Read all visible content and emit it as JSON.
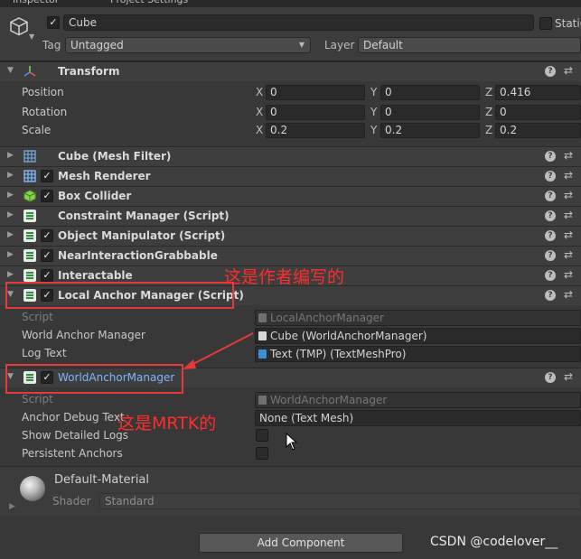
{
  "tabs": [
    "Inspector",
    "Project Settings"
  ],
  "object": {
    "name": "Cube",
    "static_label": "Static",
    "tag_label": "Tag",
    "tag_value": "Untagged",
    "layer_label": "Layer",
    "layer_value": "Default"
  },
  "transform": {
    "title": "Transform",
    "rows": [
      {
        "label": "Position",
        "x": "0",
        "y": "0",
        "z": "0.416"
      },
      {
        "label": "Rotation",
        "x": "0",
        "y": "0",
        "z": "0"
      },
      {
        "label": "Scale",
        "x": "0.2",
        "y": "0.2",
        "z": "0.2"
      }
    ],
    "axes": {
      "x": "X",
      "y": "Y",
      "z": "Z"
    }
  },
  "components": [
    {
      "name": "Cube (Mesh Filter)",
      "icon": "mesh-filter-icon",
      "checkbox": false
    },
    {
      "name": "Mesh Renderer",
      "icon": "mesh-renderer-icon",
      "checkbox": true
    },
    {
      "name": "Box Collider",
      "icon": "box-collider-icon",
      "checkbox": true
    },
    {
      "name": "Constraint Manager (Script)",
      "icon": "script-icon",
      "checkbox": false
    },
    {
      "name": "Object Manipulator (Script)",
      "icon": "script-icon",
      "checkbox": true
    },
    {
      "name": "NearInteractionGrabbable",
      "icon": "script-icon",
      "checkbox": true
    },
    {
      "name": "Interactable",
      "icon": "script-icon",
      "checkbox": true
    }
  ],
  "local_anchor": {
    "title": "Local Anchor Manager (Script)",
    "script_label": "Script",
    "script_value": "LocalAnchorManager",
    "wam_label": "World Anchor Manager",
    "wam_value": "Cube (WorldAnchorManager)",
    "log_label": "Log Text",
    "log_value": "Text (TMP) (TextMeshPro)"
  },
  "world_anchor": {
    "title": "WorldAnchorManager",
    "script_label": "Script",
    "script_value": "WorldAnchorManager",
    "debug_label": "Anchor Debug Text",
    "debug_value": "None (Text Mesh)",
    "show_logs_label": "Show Detailed Logs",
    "persistent_label": "Persistent Anchors"
  },
  "material": {
    "name": "Default-Material",
    "shader_label": "Shader",
    "shader_value": "Standard"
  },
  "add_component_label": "Add Component",
  "annotations": {
    "author": "这是作者编写的",
    "mrtk": "这是MRTK的"
  },
  "watermark": "CSDN @codelover__",
  "colors": {
    "annotation": "#ff2d2d",
    "link_blue": "#7fb4ff",
    "panel": "#383838"
  }
}
